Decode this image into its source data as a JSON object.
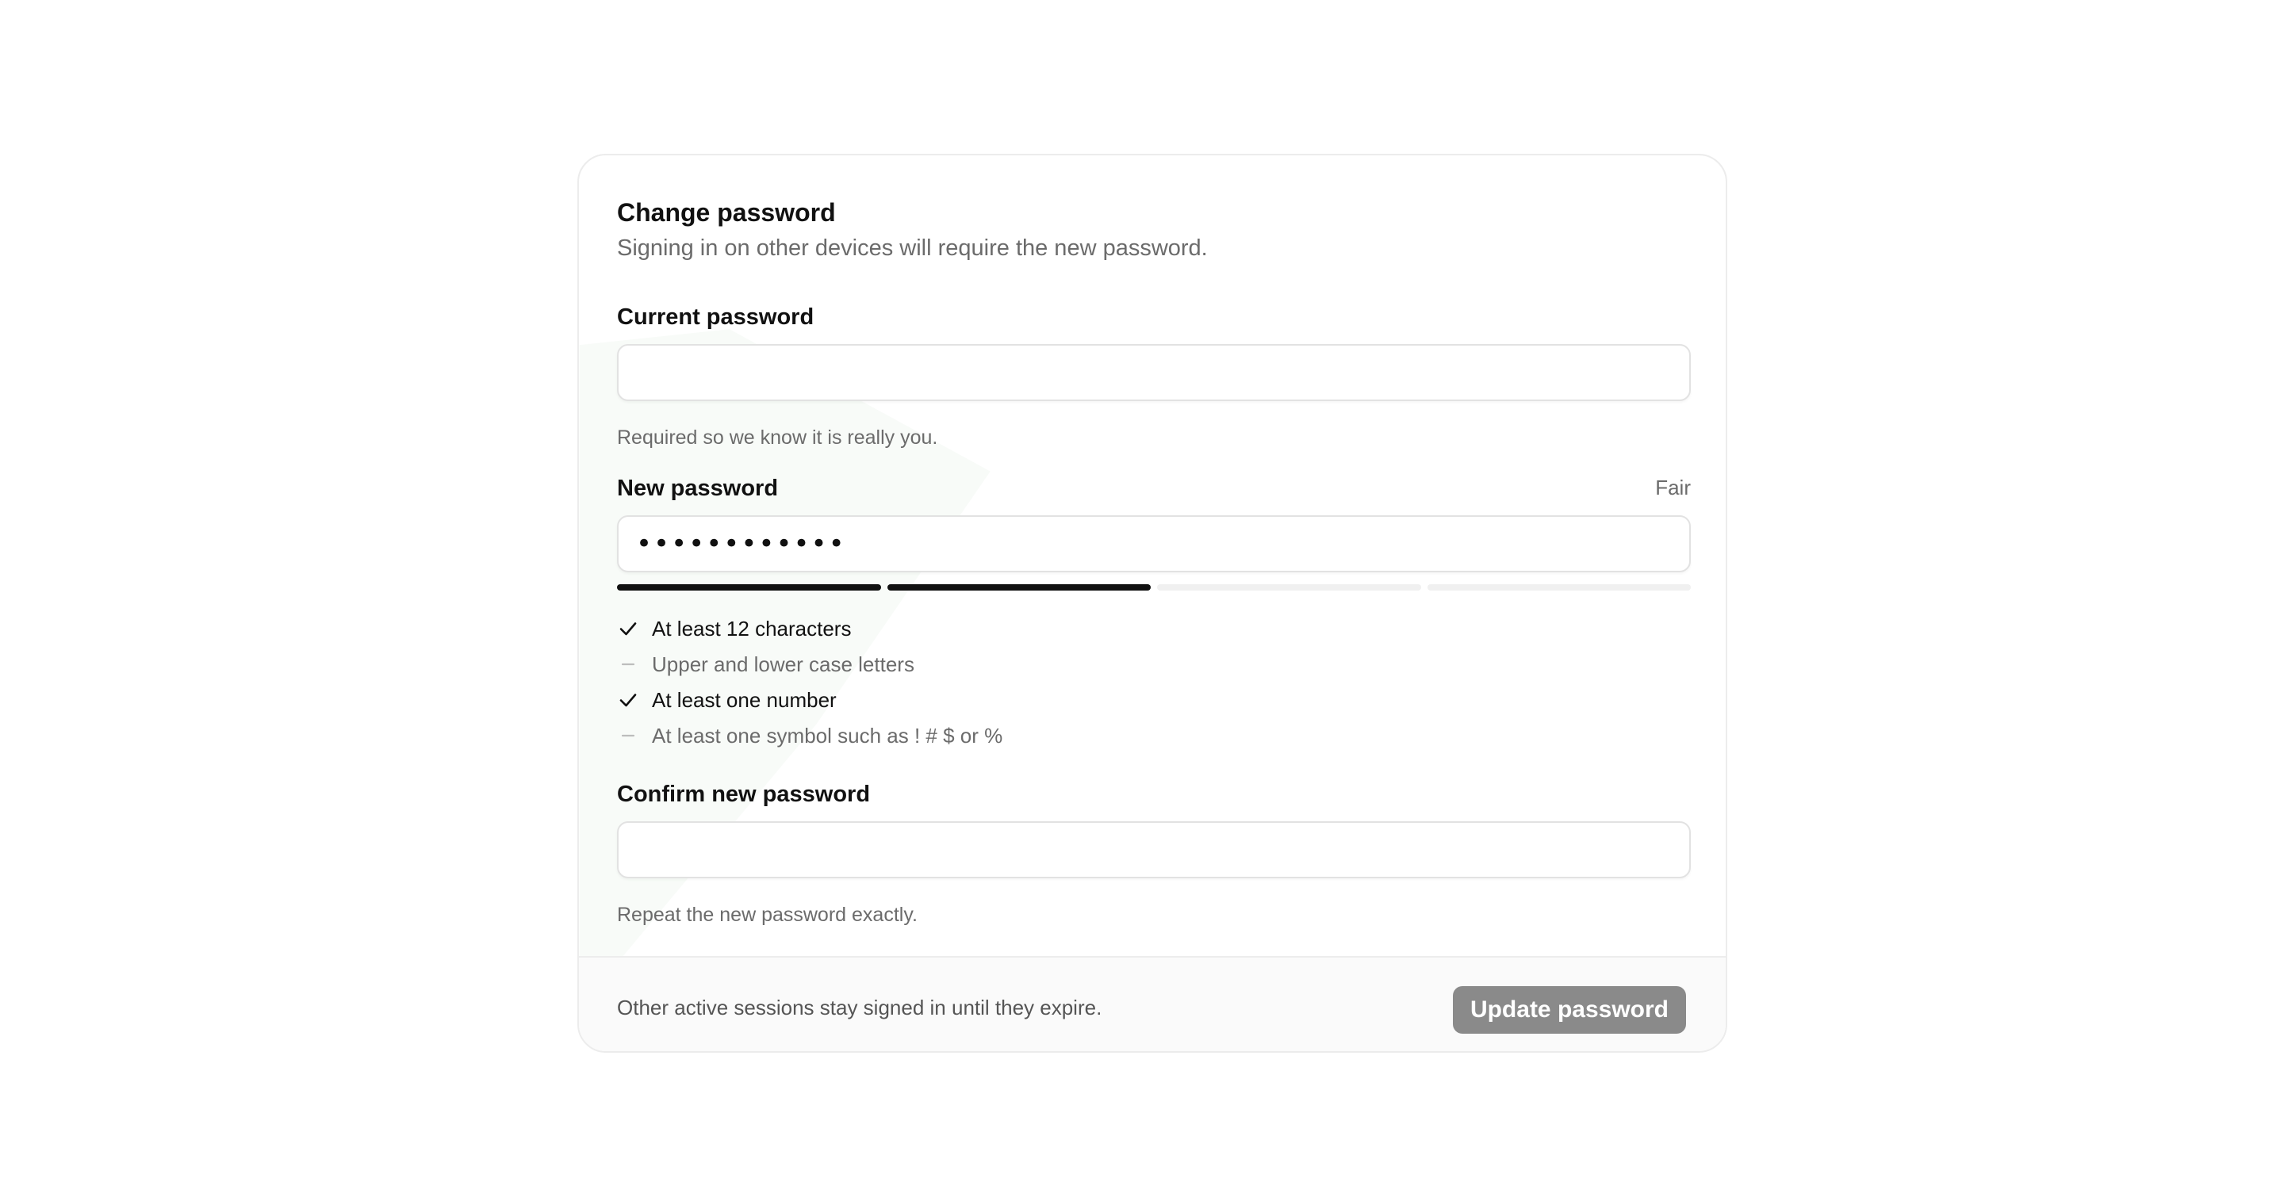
{
  "form": {
    "title": "Change password",
    "subtitle": "Signing in on other devices will require the new password.",
    "current": {
      "label": "Current password",
      "value": "",
      "hint": "Required so we know it is really you."
    },
    "new": {
      "label": "New password",
      "value": "••••••••••••",
      "strength_label": "Fair",
      "strength_level": 0.5,
      "requirements": [
        {
          "text": "At least 12 characters",
          "met": true
        },
        {
          "text": "Upper and lower case letters",
          "met": false
        },
        {
          "text": "At least one number",
          "met": true
        },
        {
          "text": "At least one symbol such as ! # $ or %",
          "met": false
        }
      ]
    },
    "confirm": {
      "label": "Confirm new password",
      "value": "",
      "hint": "Repeat the new password exactly."
    }
  },
  "footer": {
    "note": "Other active sessions stay signed in until they expire.",
    "button_label": "Update password"
  },
  "colors": {
    "text": "#111111",
    "muted": "#6b6b6b",
    "meter_on": "#111111",
    "meter_off": "#f0f0f0",
    "button_bg": "#8a8a8a"
  }
}
